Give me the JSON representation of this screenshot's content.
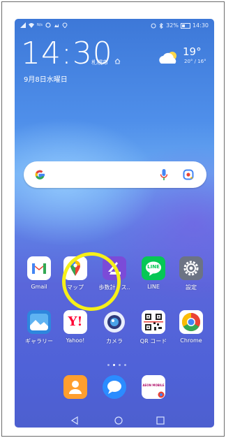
{
  "status_bar": {
    "left_text": "N/s",
    "right_text": "32%",
    "time": "14:30",
    "icons": [
      "signal-icon",
      "wifi-icon",
      "data-speed-icon",
      "notification-icon",
      "gallery-notif-icon",
      "location-icon",
      "alarm-icon",
      "bluetooth-icon",
      "battery-icon"
    ]
  },
  "clock": {
    "time": "14:30",
    "city": "札幌市",
    "date": "9月8日水曜日"
  },
  "weather": {
    "temp": "19°",
    "range": "20° / 16°"
  },
  "search_bar": {
    "brand": "G"
  },
  "apps_row1": [
    {
      "label": "Gmail",
      "icon": "gmail-icon"
    },
    {
      "label": "マップ",
      "icon": "google-maps-icon"
    },
    {
      "label": "歩数計 - ス..",
      "icon": "pedometer-icon"
    },
    {
      "label": "LINE",
      "icon": "line-icon"
    },
    {
      "label": "設定",
      "icon": "settings-icon"
    }
  ],
  "apps_row2": [
    {
      "label": "ギャラリー",
      "icon": "gallery-icon"
    },
    {
      "label": "Yahoo!",
      "icon": "yahoo-icon"
    },
    {
      "label": "カメラ",
      "icon": "camera-icon"
    },
    {
      "label": "QR コード",
      "icon": "qr-code-icon"
    },
    {
      "label": "Chrome",
      "icon": "chrome-icon"
    }
  ],
  "dock": [
    {
      "label": "",
      "icon": "contacts-icon"
    },
    {
      "label": "",
      "icon": "messages-icon"
    },
    {
      "label": "",
      "icon": "aeon-mobile-icon",
      "text": "AEON MOBILE"
    }
  ],
  "page_indicator": {
    "count": 4,
    "active": 2
  },
  "line_logo_text": "LINE",
  "yahoo_logo_text": "Y!",
  "colors": {
    "highlight": "#f6f018",
    "gmail_red": "#ea4335",
    "line_green": "#06c755",
    "yahoo_red": "#ff0033"
  }
}
